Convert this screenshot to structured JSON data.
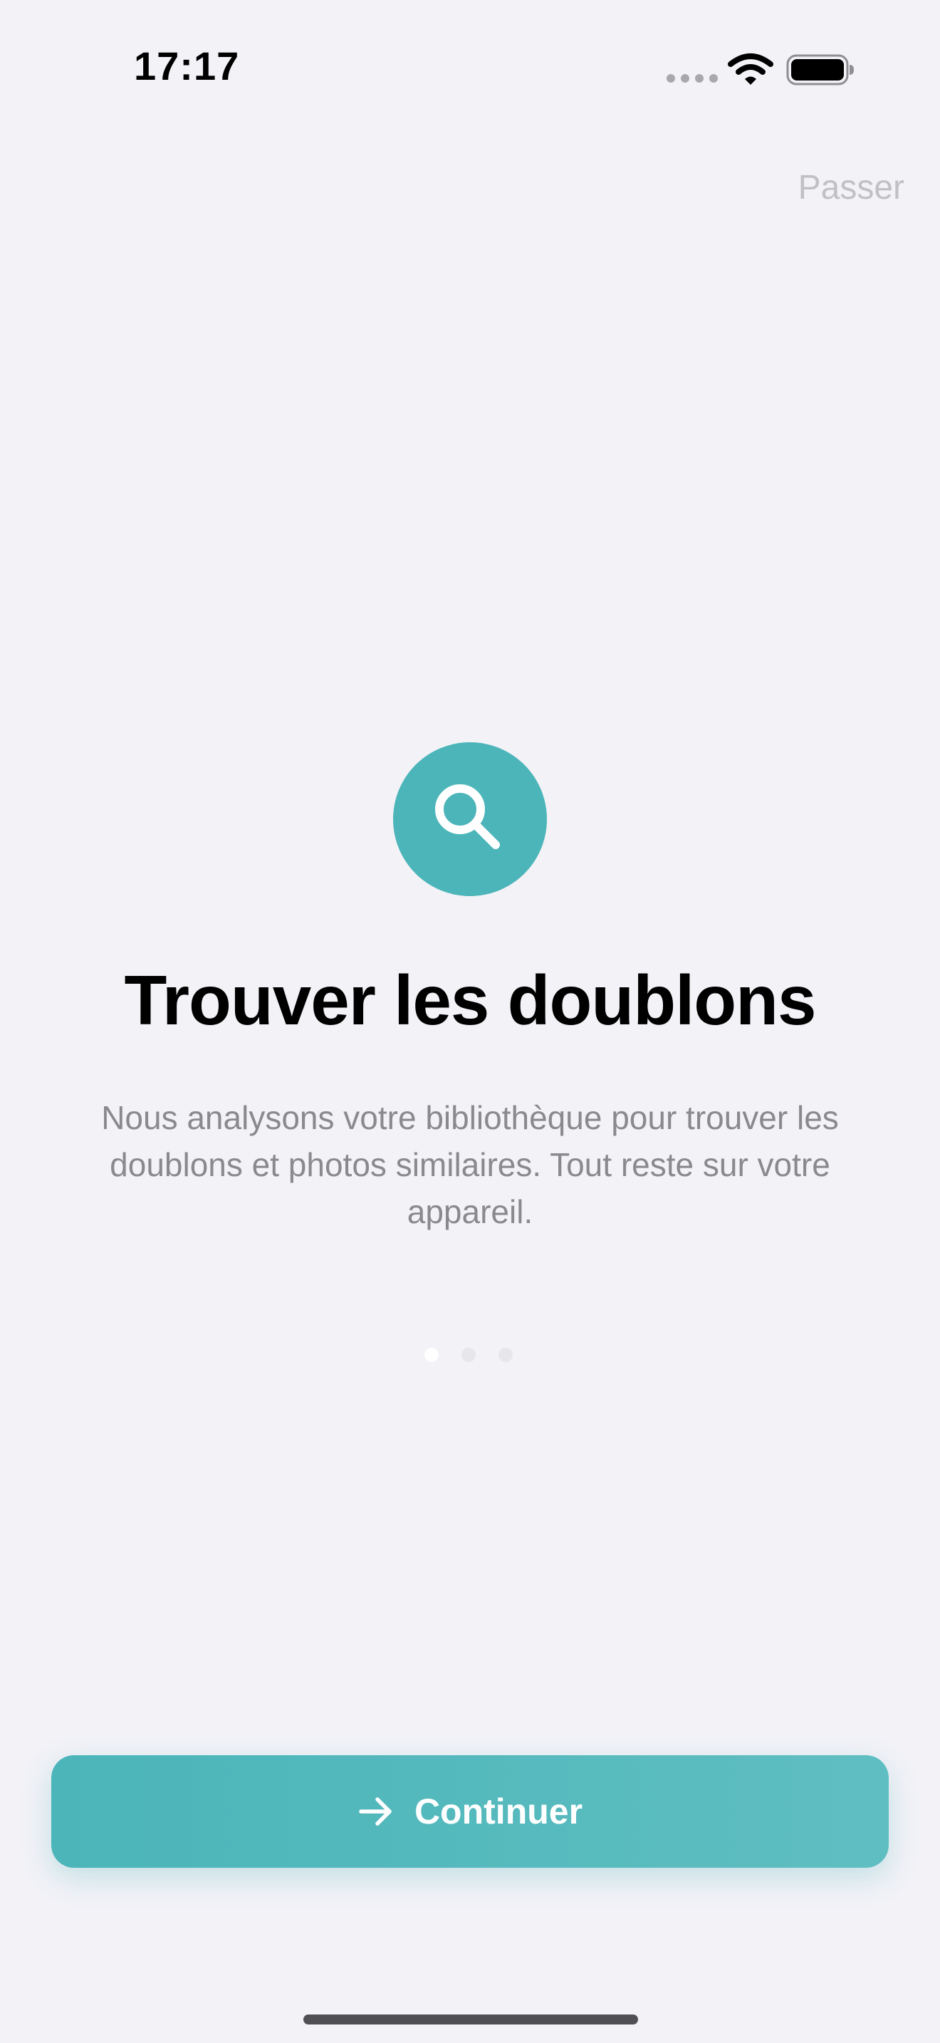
{
  "status_bar": {
    "time": "17:17",
    "icons": [
      "cellular-signal-icon",
      "wifi-icon",
      "battery-icon"
    ]
  },
  "header": {
    "skip_label": "Passer"
  },
  "onboarding": {
    "icon": "magnifying-glass-icon",
    "title": "Trouver les doublons",
    "description": "Nous analysons votre bibliothèque pour trouver les doublons et photos similaires. Tout reste sur votre appareil.",
    "page_indicator": {
      "current_page": 1,
      "total_pages": 3
    }
  },
  "footer": {
    "continue_label": "Continuer",
    "continue_icon": "arrow-right-icon"
  },
  "colors": {
    "accent": "#4bb5b9",
    "background": "#f2f2f7",
    "secondary_text": "#8a8a8e",
    "skip_text": "#c0c0c5"
  }
}
